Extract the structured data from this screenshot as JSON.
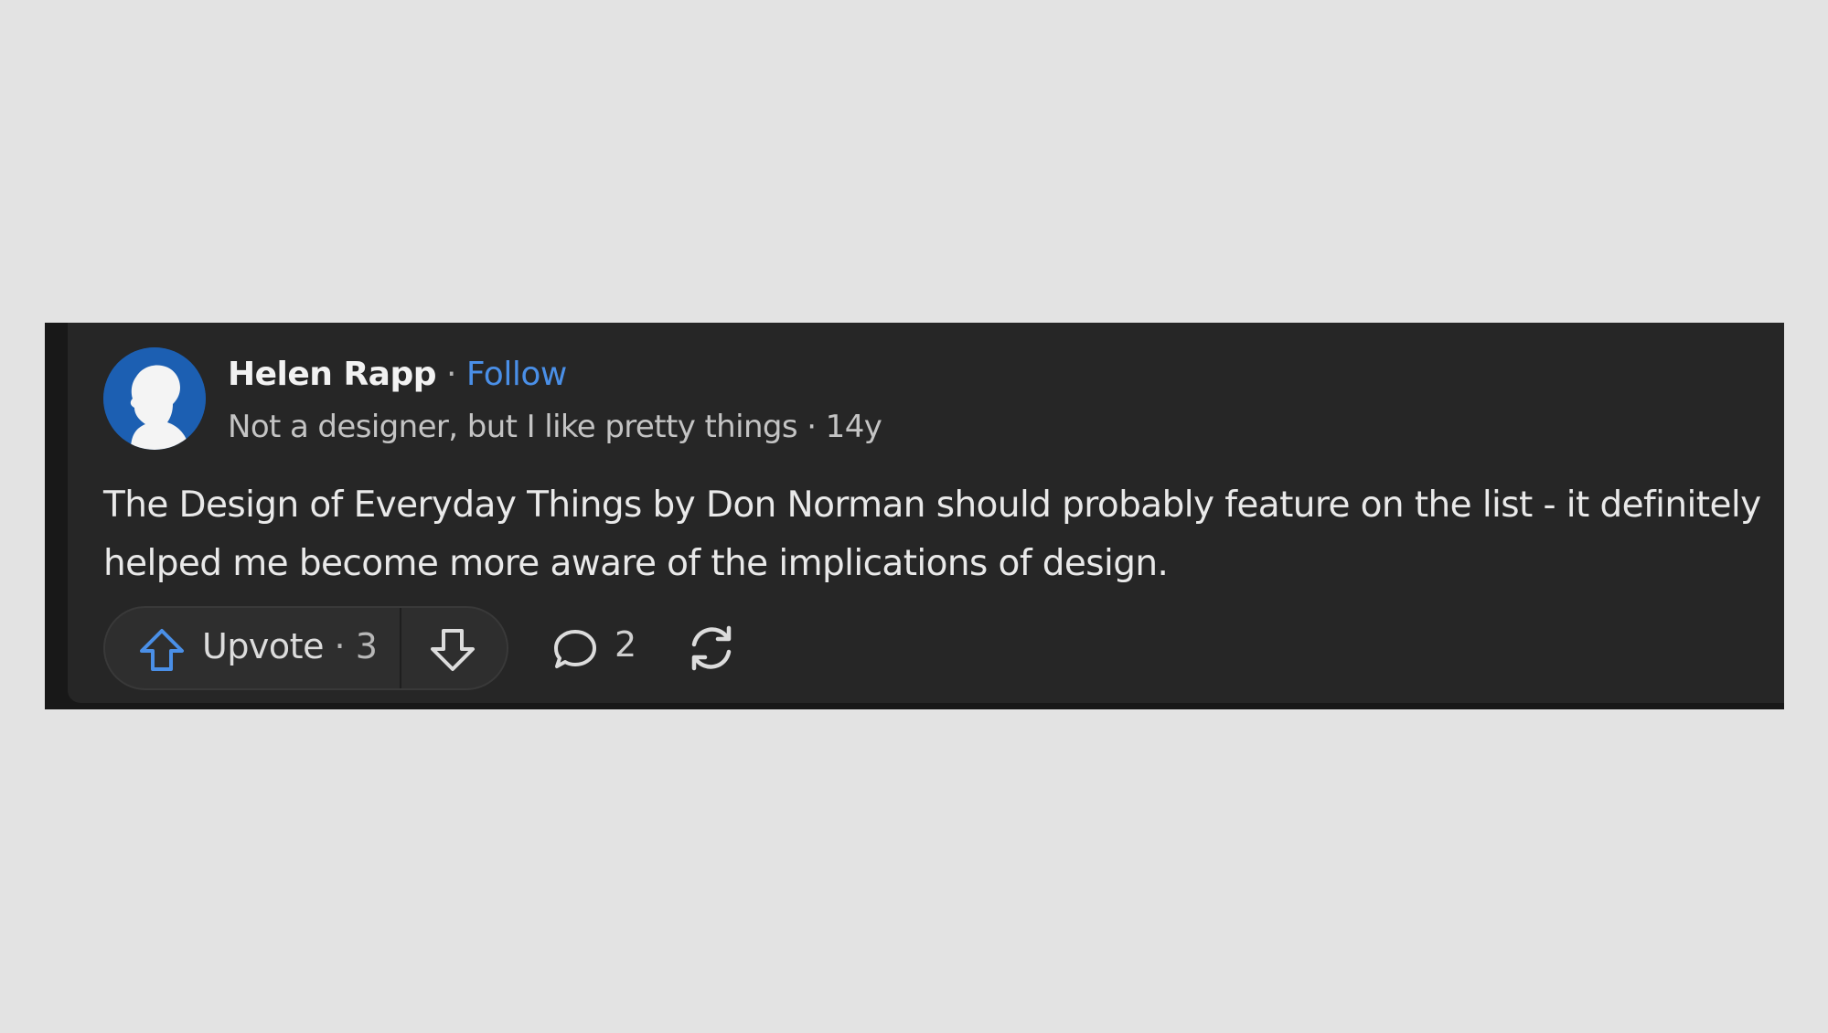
{
  "author": {
    "name": "Helen Rapp",
    "separator": "·",
    "follow_label": "Follow",
    "credential": "Not a designer, but I like pretty things",
    "age_separator": "·",
    "age": "14y"
  },
  "answer": {
    "text": "The Design of Everyday Things by Don Norman should probably feature on the list - it definitely helped me become more aware of the implications of design."
  },
  "actions": {
    "upvote_label": "Upvote",
    "upvote_separator": "·",
    "upvote_count": "3",
    "comment_count": "2"
  },
  "icons": {
    "upvote": "arrow-up-icon",
    "downvote": "arrow-down-icon",
    "comment": "speech-bubble-icon",
    "share": "share-cycle-icon",
    "avatar": "silhouette-profile-icon"
  },
  "colors": {
    "page_background": "#e3e3e3",
    "card_background": "#262626",
    "follow": "#4a8fe7",
    "upvote_icon": "#4a8fe7",
    "avatar_background": "#1c5fb2"
  }
}
